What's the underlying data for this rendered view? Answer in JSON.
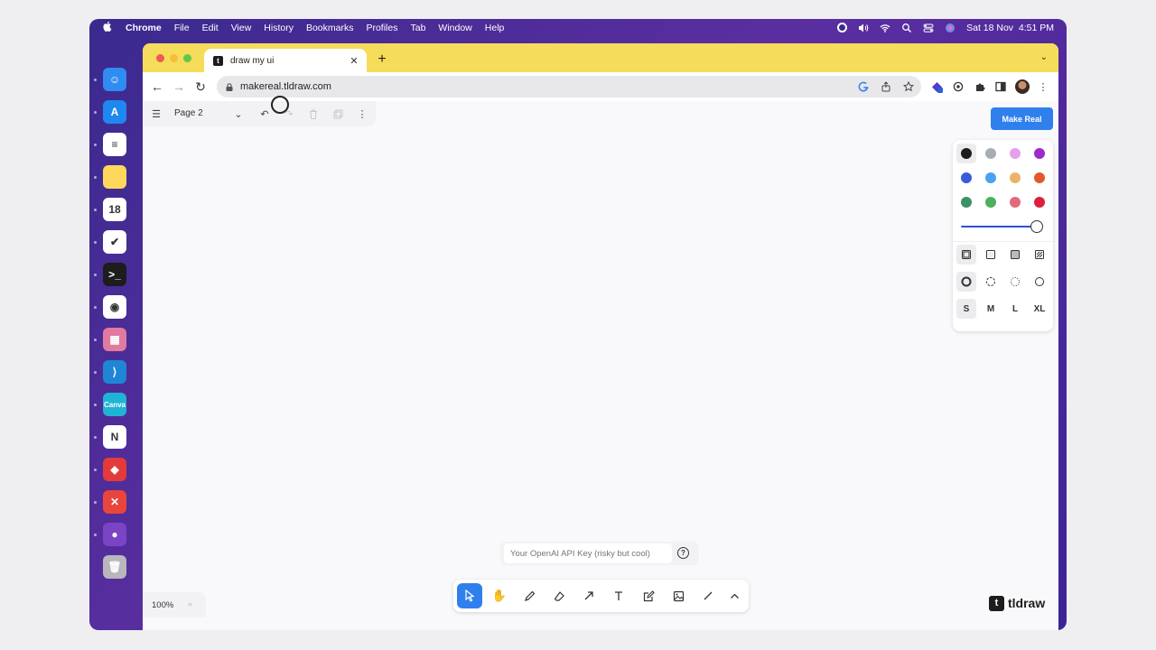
{
  "menubar": {
    "app_name": "Chrome",
    "items": [
      "File",
      "Edit",
      "View",
      "History",
      "Bookmarks",
      "Profiles",
      "Tab",
      "Window",
      "Help"
    ],
    "datetime": "Sat 18 Nov  4:51 PM"
  },
  "dock": {
    "apps": [
      {
        "name": "finder",
        "color": "#2f8cf0",
        "glyph": "☺"
      },
      {
        "name": "app-store",
        "color": "#1e88f0",
        "glyph": "A"
      },
      {
        "name": "reminders",
        "color": "#ffffff",
        "glyph": "≡"
      },
      {
        "name": "notes",
        "color": "#fdd85d",
        "glyph": ""
      },
      {
        "name": "calendar",
        "color": "#ffffff",
        "glyph": "18"
      },
      {
        "name": "things",
        "color": "#ffffff",
        "glyph": "✔"
      },
      {
        "name": "terminal",
        "color": "#1d1d1d",
        "glyph": ">_"
      },
      {
        "name": "chrome",
        "color": "#ffffff",
        "glyph": "◉"
      },
      {
        "name": "launchpad",
        "color": "#e07aa0",
        "glyph": "▦"
      },
      {
        "name": "vscode",
        "color": "#1f86d6",
        "glyph": "⟩"
      },
      {
        "name": "canva",
        "color": "#20b4d4",
        "glyph": "Canva"
      },
      {
        "name": "notion",
        "color": "#ffffff",
        "glyph": "N"
      },
      {
        "name": "anydesk",
        "color": "#e33b3b",
        "glyph": "◆"
      },
      {
        "name": "remote-desktop",
        "color": "#e8453c",
        "glyph": "✕"
      },
      {
        "name": "github-desktop",
        "color": "#7a45c4",
        "glyph": "●"
      },
      {
        "name": "trash",
        "color": "#b7b7bd",
        "glyph": "🗑"
      }
    ]
  },
  "browser": {
    "tab_title": "draw my ui",
    "url": "makereal.tldraw.com"
  },
  "app": {
    "page_name": "Page 2",
    "make_real_label": "Make Real",
    "colors": [
      "#1d1d1d",
      "#a8acb4",
      "#e4a0ec",
      "#9d2bc9",
      "#3a5bd9",
      "#4ba1f1",
      "#e9b46a",
      "#e0592a",
      "#3d9068",
      "#4cb05e",
      "#e16a7c",
      "#d9213a"
    ],
    "selected_color": "#1d1d1d",
    "opacity_percent": 100,
    "sizes": [
      "S",
      "M",
      "L",
      "XL"
    ],
    "selected_size": "S",
    "api_placeholder": "Your OpenAI API Key (risky but cool)",
    "help_glyph": "?",
    "zoom_label": "100%",
    "zoom_arrows": "»",
    "brand_mark": "t",
    "brand_text": "tldraw"
  }
}
